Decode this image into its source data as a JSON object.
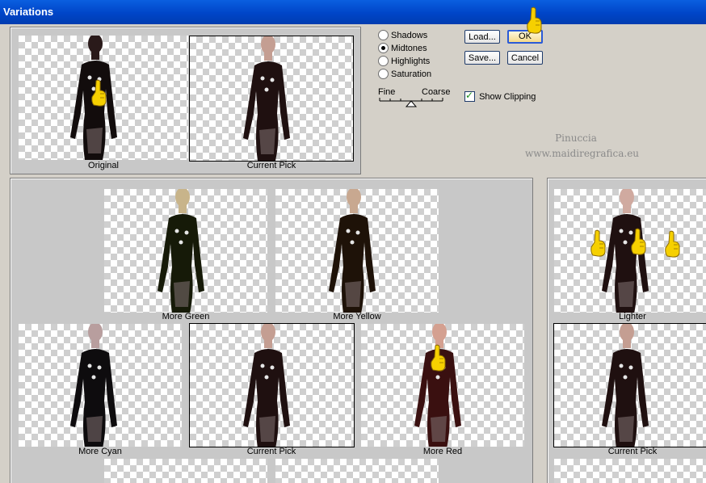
{
  "window": {
    "title": "Variations"
  },
  "modes": [
    {
      "label": "Shadows",
      "selected": false
    },
    {
      "label": "Midtones",
      "selected": true
    },
    {
      "label": "Highlights",
      "selected": false
    },
    {
      "label": "Saturation",
      "selected": false
    }
  ],
  "slider": {
    "fine_label": "Fine",
    "coarse_label": "Coarse"
  },
  "buttons": {
    "load": "Load...",
    "ok": "OK",
    "save": "Save...",
    "cancel": "Cancel"
  },
  "show_clipping": {
    "label": "Show Clipping",
    "checked": true
  },
  "watermark": {
    "line1": "Pinuccia",
    "line2": "www.maidiregrafica.eu"
  },
  "top_previews": {
    "original": "Original",
    "current_pick": "Current Pick"
  },
  "color_grid": {
    "more_green": "More Green",
    "more_yellow": "More Yellow",
    "more_cyan": "More Cyan",
    "current_pick": "Current Pick",
    "more_red": "More Red"
  },
  "brightness": {
    "lighter": "Lighter",
    "current_pick": "Current Pick"
  },
  "colors": {
    "titlebar": "#0045c8",
    "panel": "#c8c8c8",
    "figure": "#1a1010",
    "pointer": "#f6d000"
  }
}
